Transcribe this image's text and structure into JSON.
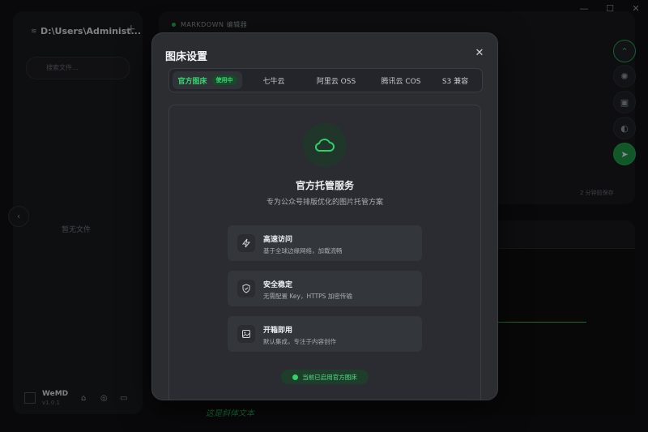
{
  "window": {
    "minimize_label": "—",
    "maximize_label": "☐",
    "close_label": "✕"
  },
  "sidebar": {
    "path": "D:\\Users\\Administ...",
    "search_placeholder": "搜索文件...",
    "empty_text": "暂无文件",
    "app_name": "WeMD",
    "version": "v1.0.1",
    "add_label": "+"
  },
  "editor": {
    "header_label": "MARKDOWN 编辑器",
    "status_text": "2 分钟前保存",
    "italic_preview": "这是斜体文本"
  },
  "modal": {
    "title": "图床设置",
    "tabs": [
      {
        "label": "官方图床",
        "badge": "使用中"
      },
      {
        "label": "七牛云"
      },
      {
        "label": "阿里云 OSS"
      },
      {
        "label": "腾讯云 COS"
      },
      {
        "label": "S3 兼容"
      }
    ],
    "service_title": "官方托管服务",
    "service_subtitle": "专为公众号排版优化的图片托管方案",
    "features": [
      {
        "title": "高速访问",
        "desc": "基于全球边缘网络，加载流畅",
        "icon": "lightning-icon"
      },
      {
        "title": "安全稳定",
        "desc": "无需配置 Key，HTTPS 加密传输",
        "icon": "shield-icon"
      },
      {
        "title": "开箱即用",
        "desc": "默认集成，专注于内容创作",
        "icon": "image-icon"
      }
    ],
    "status": "当前已启用官方图床"
  },
  "colors": {
    "accent": "#22c35e",
    "modal_bg": "#2b2d31",
    "page_bg": "#111214"
  }
}
